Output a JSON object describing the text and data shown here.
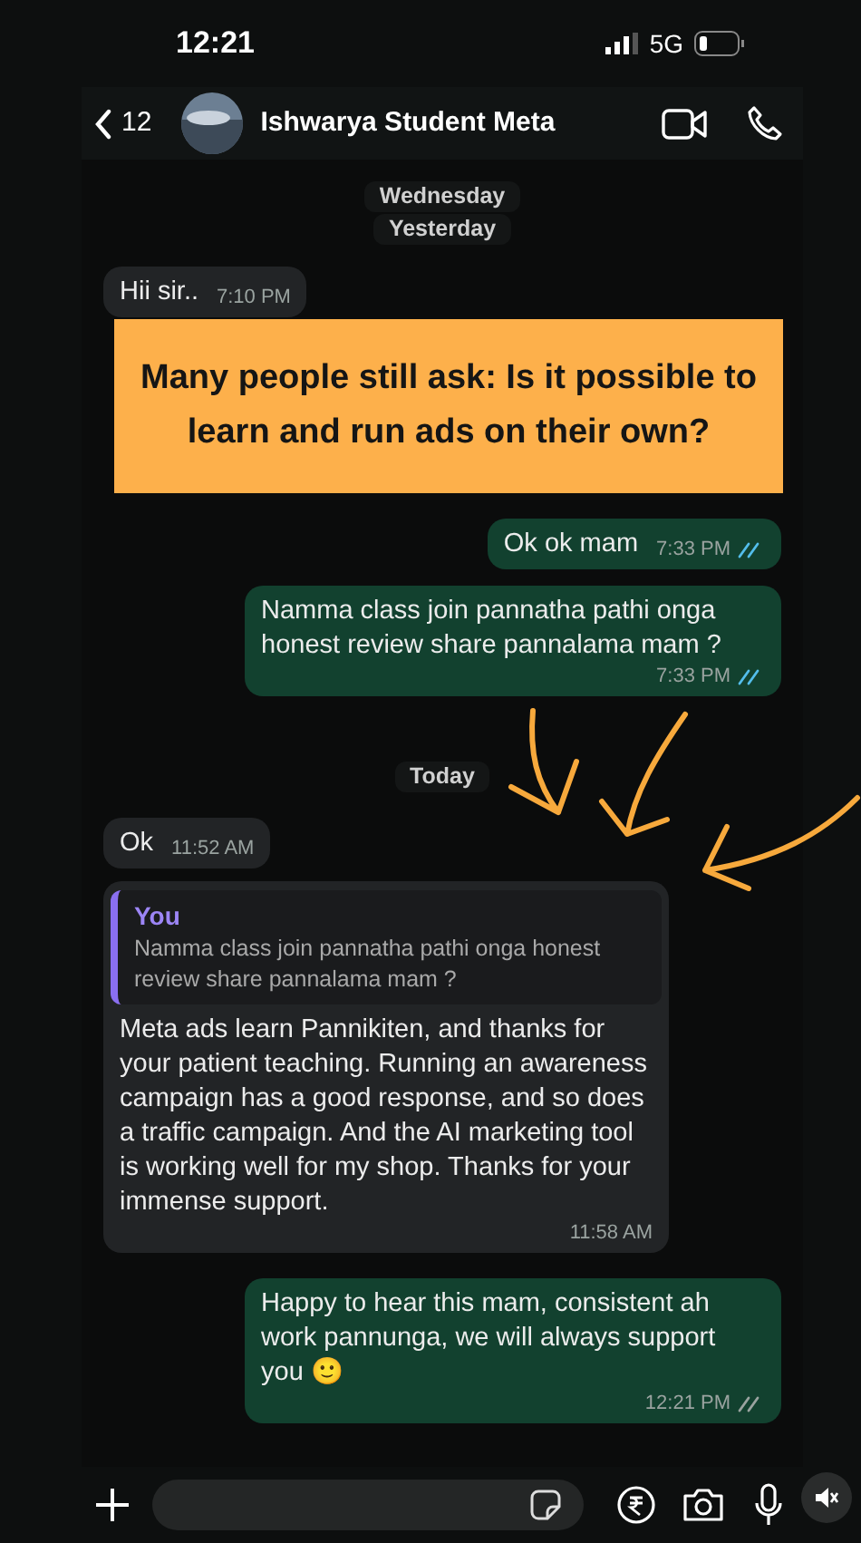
{
  "status_bar": {
    "time": "12:21",
    "network": "5G"
  },
  "header": {
    "back_count": "12",
    "contact_name": "Ishwarya Student Meta"
  },
  "messages": [
    {
      "kind": "date",
      "text": "Wednesday"
    },
    {
      "kind": "date",
      "text": "Yesterday"
    },
    {
      "kind": "in",
      "text": "Hii sir..",
      "time": "7:10 PM"
    },
    {
      "kind": "out",
      "text": "Ok ok mam",
      "time": "7:33 PM",
      "read": true
    },
    {
      "kind": "out",
      "text": "Namma class join pannatha pathi onga honest review share pannalama mam ?",
      "time": "7:33 PM",
      "read": true
    },
    {
      "kind": "date",
      "text": "Today"
    },
    {
      "kind": "in",
      "text": "Ok",
      "time": "11:52 AM"
    },
    {
      "kind": "in",
      "quote": {
        "author": "You",
        "text": "Namma class join pannatha pathi onga honest review share pannalama mam ?"
      },
      "text": "Meta ads learn Pannikiten, and thanks for your patient teaching. Running an awareness campaign has a good response, and so does a traffic campaign. And the AI marketing tool is working well for my shop. Thanks for your immense support.",
      "time": "11:58 AM"
    },
    {
      "kind": "out",
      "text": "Happy to hear this mam, consistent ah work pannunga, we will always support you",
      "emoji": "🙂",
      "time": "12:21 PM",
      "read": false
    }
  ],
  "banner": {
    "text": "Many people still ask: Is it possible to learn and run ads on their own?"
  }
}
